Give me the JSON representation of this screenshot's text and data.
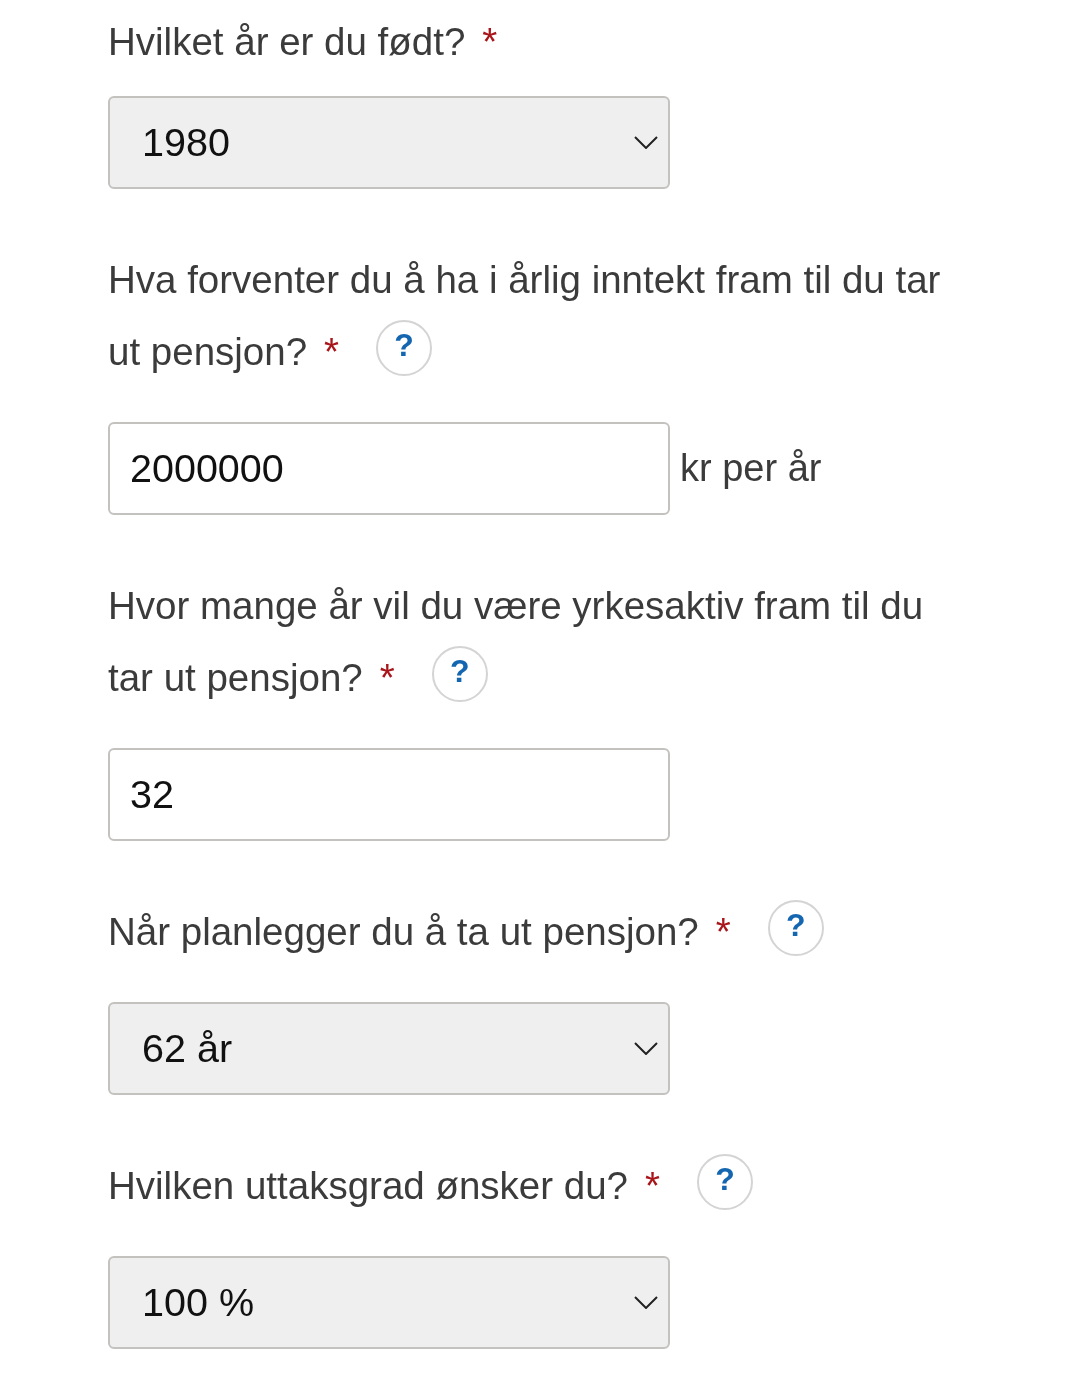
{
  "questions": [
    {
      "kind": "select",
      "label_lines": [
        "Hvilket år er du født?"
      ],
      "required_mark": "*",
      "value": "1980"
    },
    {
      "kind": "input",
      "label_lines": [
        "Hva forventer du å ha i årlig inntekt fram til du tar",
        "ut pensjon?"
      ],
      "required_mark": "*",
      "help": "?",
      "value": "2000000",
      "suffix": "kr per år"
    },
    {
      "kind": "input",
      "label_lines": [
        "Hvor mange år vil du være yrkesaktiv fram til du",
        "tar ut pensjon?"
      ],
      "required_mark": "*",
      "help": "?",
      "value": "32"
    },
    {
      "kind": "select",
      "label_lines": [
        "Når planlegger du å ta ut pensjon?"
      ],
      "required_mark": "*",
      "help": "?",
      "value": "62 år"
    },
    {
      "kind": "select",
      "label_lines": [
        "Hvilken uttaksgrad ønsker du?"
      ],
      "required_mark": "*",
      "help": "?",
      "value": "100 %"
    }
  ]
}
